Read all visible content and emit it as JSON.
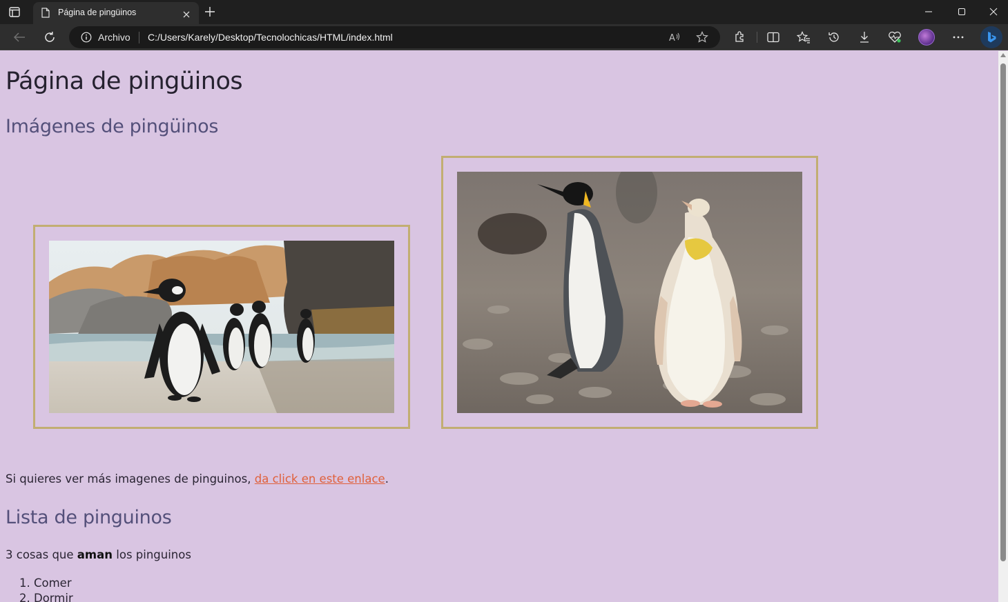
{
  "browser": {
    "tab_title": "Página de pingüinos",
    "site_label": "Archivo",
    "url": "C:/Users/Karely/Desktop/Tecnolochicas/HTML/index.html",
    "icons": [
      "sidebar-toggle-icon",
      "page-icon",
      "close-icon",
      "plus-icon",
      "minimize-icon",
      "maximize-icon",
      "window-close-icon",
      "back-arrow-icon",
      "refresh-icon",
      "info-icon",
      "read-aloud-icon",
      "favorite-star-icon",
      "extensions-icon",
      "split-screen-icon",
      "favorites-icon",
      "history-icon",
      "download-icon",
      "performance-icon",
      "profile-avatar",
      "more-icon",
      "copilot-icon"
    ]
  },
  "page": {
    "title": "Página de pingüinos",
    "images_heading": "Imágenes de pingüinos",
    "images": [
      {
        "description": "Penguins walking on a beach near rocks"
      },
      {
        "description": "King penguin next to a yellow penguin on a pebble beach"
      }
    ],
    "para_prefix": "Si quieres ver más imagenes de pinguinos, ",
    "link_text": "da click en este enlace",
    "para_suffix": ".",
    "list_heading": "Lista de pinguinos",
    "list_intro_prefix": "3 cosas que ",
    "list_intro_bold": "aman",
    "list_intro_suffix": " los pinguinos",
    "list_items": [
      "1. Comer",
      "2. Dormir"
    ]
  },
  "colors": {
    "page_background": "#d9c5e2",
    "frame_border": "#c2ae72",
    "heading2": "#54507a",
    "link": "#e0603a"
  }
}
